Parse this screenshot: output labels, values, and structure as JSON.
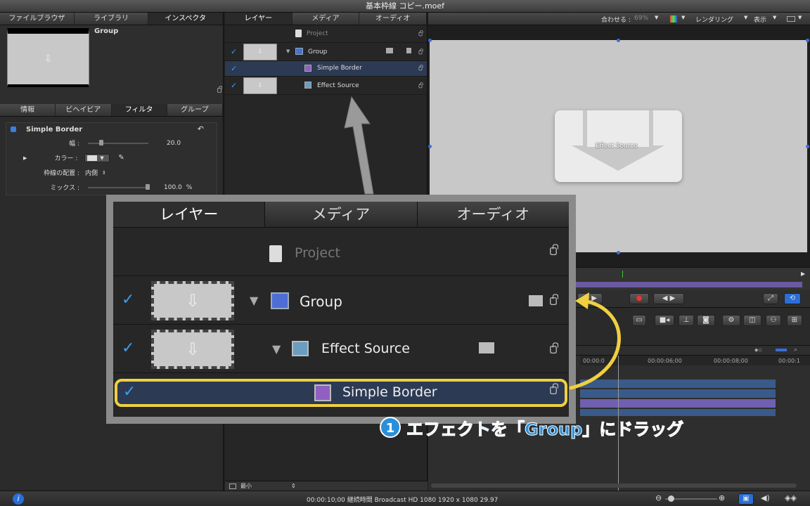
{
  "window": {
    "title": "基本枠線 コピー.moef"
  },
  "left_tabs": [
    "ファイルブラウザ",
    "ライブラリ",
    "インスペクタ"
  ],
  "preview": {
    "name": "Group"
  },
  "inspector_tabs": [
    "情報",
    "ビヘイビア",
    "フィルタ",
    "グループ"
  ],
  "filter": {
    "name": "Simple Border",
    "params": [
      {
        "label": "幅 :",
        "value": "20.0"
      },
      {
        "label": "カラー :"
      },
      {
        "label": "枠線の配置 :",
        "value": "内側"
      },
      {
        "label": "ミックス :",
        "value": "100.0",
        "unit": "%"
      }
    ]
  },
  "layers_tabs": [
    "レイヤー",
    "メディア",
    "オーディオ"
  ],
  "layers": {
    "project": "Project",
    "group": "Group",
    "simple_border": "Simple Border",
    "effect_source": "Effect Source",
    "footer_size": "最小"
  },
  "canvas_toolbar": {
    "fit": "合わせる :",
    "zoom": "69%",
    "render": "レンダリング",
    "view": "表示"
  },
  "canvas": {
    "overlay_label": "Effect Source"
  },
  "timeline": {
    "ticks": [
      "00:00:0",
      "00:00:06;00",
      "00:00:08;00",
      "00:00:1"
    ]
  },
  "zoomed": {
    "tabs": [
      "レイヤー",
      "メディア",
      "オーディオ"
    ],
    "project": "Project",
    "group": "Group",
    "effect_source": "Effect Source",
    "simple_border": "Simple Border"
  },
  "annotation": {
    "number": "1",
    "text": "エフェクトを「Group」にドラッグ"
  },
  "status": {
    "text": "00:00:10;00 継続時間 Broadcast HD 1080 1920 x 1080 29.97"
  },
  "colors": {
    "accent": "#3a9df0",
    "highlight": "#f0d040",
    "annotation": "#2a8fd8"
  }
}
